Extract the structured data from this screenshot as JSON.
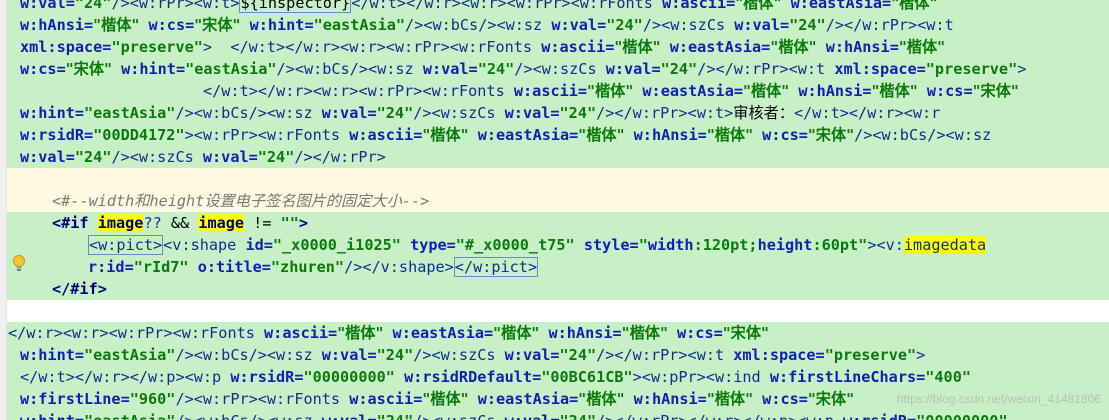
{
  "editor": {
    "lines": [
      "w:val=\"24\"/><w:rPr><w:t>${inspector}</w:t></w:r><w:r><w:rPr><w:rFonts w:ascii=\"楷体\" w:eastAsia=\"楷体\"",
      "w:hAnsi=\"楷体\" w:cs=\"宋体\" w:hint=\"eastAsia\"/><w:bCs/><w:sz w:val=\"24\"/><w:szCs w:val=\"24\"/></w:rPr><w:t",
      "xml:space=\"preserve\">  </w:t></w:r><w:r><w:rPr><w:rFonts w:ascii=\"楷体\" w:eastAsia=\"楷体\" w:hAnsi=\"楷体\"",
      "w:cs=\"宋体\" w:hint=\"eastAsia\"/><w:bCs/><w:sz w:val=\"24\"/><w:szCs w:val=\"24\"/></w:rPr><w:t xml:space=\"preserve\">",
      "</w:t></w:r><w:r><w:rPr><w:rFonts w:ascii=\"楷体\" w:eastAsia=\"楷体\" w:hAnsi=\"楷体\" w:cs=\"宋体\"",
      "w:hint=\"eastAsia\"/><w:bCs/><w:sz w:val=\"24\"/><w:szCs w:val=\"24\"/></w:rPr><w:t>审核者：</w:t></w:r><w:r",
      "w:rsidR=\"00DD4172\"><w:rPr><w:rFonts w:ascii=\"楷体\" w:eastAsia=\"楷体\" w:hAnsi=\"楷体\" w:cs=\"宋体\"/><w:bCs/><w:sz",
      "w:val=\"24\"/><w:szCs w:val=\"24\"/></w:rPr>",
      "",
      "<#--width和height设置电子签名图片的固定大小-->",
      "<#if image?? && image != \"\">",
      "<w:pict><v:shape id=\"_x0000_i1025\" type=\"#_x0000_t75\" style=\"width:120pt;height:60pt\"><v:imagedata",
      "r:id=\"rId7\" o:title=\"zhuren\"/></v:shape></w:pict>",
      "</#if>",
      "",
      "</w:r><w:r><w:rPr><w:rFonts w:ascii=\"楷体\" w:eastAsia=\"楷体\" w:hAnsi=\"楷体\" w:cs=\"宋体\"",
      "w:hint=\"eastAsia\"/><w:bCs/><w:sz w:val=\"24\"/><w:szCs w:val=\"24\"/></w:rPr><w:t xml:space=\"preserve\">",
      "</w:t></w:r></w:p><w:p w:rsidR=\"00000000\" w:rsidRDefault=\"00BC61CB\"><w:pPr><w:ind w:firstLineChars=\"400\"",
      "w:firstLine=\"960\"/><w:rPr><w:rFonts w:ascii=\"楷体\" w:eastAsia=\"楷体\" w:hAnsi=\"楷体\" w:cs=\"宋体\"",
      "w:hint=\"eastAsia\"/><w:bCs/><w:sz w:val=\"24\"/><w:szCs w:val=\"24\"/></w:rPr></w:r></w:p><w:p w:rsidR=\"00000000\""
    ],
    "watermark": "https://blog.csdn.net/weixin_41481806",
    "colors": {
      "highlight": "#c7f0c7",
      "match": "#ffff00",
      "tag": "#0d2f8f",
      "attr": "#0d22b3",
      "value": "#0a7a0a",
      "comment": "#7a7a7a"
    },
    "icons": {
      "gutter": "lightbulb-icon"
    }
  }
}
